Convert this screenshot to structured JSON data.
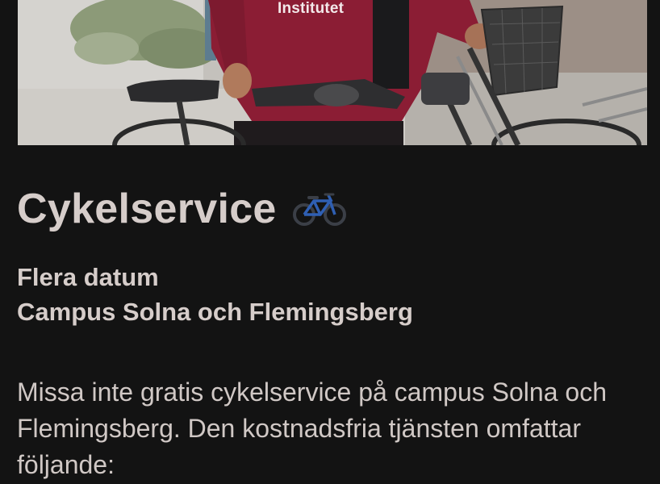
{
  "hero": {
    "logo_text": "Institutet"
  },
  "article": {
    "title": "Cykelservice",
    "title_icon": "bicycle-icon",
    "date_line": "Flera datum",
    "location_line": "Campus Solna och Flemingsberg",
    "body": "Missa inte gratis cykelservice på campus Solna och Flemingsberg. Den kostnadsfria tjänsten omfattar följande:"
  },
  "colors": {
    "background": "#131313",
    "text": "#d6cdca",
    "hoodie": "#8a1c33"
  }
}
